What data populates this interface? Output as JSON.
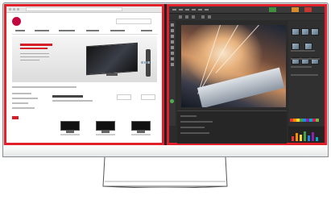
{
  "colors": {
    "highlight_border": "#e0202a",
    "brand_red": "#c3073f",
    "editor_bg": "#2b2b2b",
    "monitor_frame": "#d9dbdd"
  },
  "left_pane": {
    "type": "website",
    "icons": [
      "brand-logo-icon"
    ]
  },
  "right_pane": {
    "type": "photo-editor",
    "icons": [
      "tool-icon",
      "thumbnail-icon",
      "color-swatch-icon"
    ]
  }
}
